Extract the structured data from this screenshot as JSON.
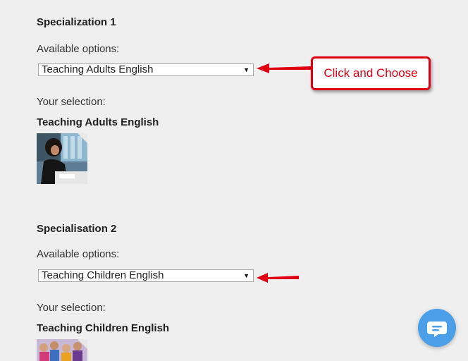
{
  "spec1": {
    "title": "Specialization 1",
    "options_label": "Available options:",
    "selected_option": "Teaching Adults English",
    "selection_label": "Your selection:",
    "selection_name": "Teaching Adults English"
  },
  "spec2": {
    "title": "Specialisation 2",
    "options_label": "Available options:",
    "selected_option": "Teaching Children English",
    "selection_label": "Your selection:",
    "selection_name": "Teaching Children English"
  },
  "callout": {
    "text": "Click and Choose"
  },
  "icons": {
    "dropdown": "caret-down-icon",
    "annotation": "red-arrow-icon",
    "chat": "chat-bubble-icon"
  },
  "colors": {
    "background": "#efefef",
    "annotation_red": "#e00012",
    "chat_blue": "#4a9fe8"
  }
}
